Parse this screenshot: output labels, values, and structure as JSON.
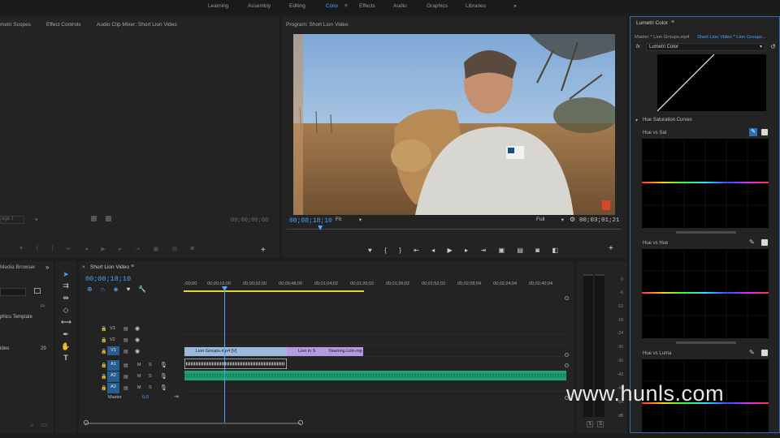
{
  "workspaces": {
    "items": [
      "Learning",
      "Assembly",
      "Editing",
      "Color",
      "Effects",
      "Audio",
      "Graphics",
      "Libraries"
    ],
    "active": "Color",
    "more": "»"
  },
  "source_panel": {
    "tabs": [
      "metri Scopes",
      "Effect Controls",
      "Audio Clip Mixer: Short Lion Video"
    ],
    "timecode_left": "age 1",
    "timecode_right": "00;00;00;00"
  },
  "program": {
    "title": "Program: Short Lion Video",
    "timecode": "00;00;18;10",
    "zoom": "Fit",
    "quality": "Full",
    "duration": "00;03;01;21",
    "playhead_fraction": 0.1
  },
  "lumetri": {
    "title": "Lumetri Color",
    "master_clip": "Master * Lion Groups.mp4",
    "sequence_clip": "Short Lion Video * Lion Groups...",
    "fx_label": "fx",
    "effect_name": "Lumetri Color",
    "section": "Hue Saturation Curves",
    "curves": [
      "Hue vs Sat",
      "Hue vs Hue",
      "Hue vs Luma"
    ]
  },
  "media": {
    "title": "Media Browser",
    "items": [
      "phics Template",
      "ideo"
    ],
    "col_header": "Fr",
    "count": "29"
  },
  "timeline": {
    "title": "Short Lion Video",
    "timecode": "00;00;18;10",
    "ruler": [
      ";00;00",
      "00;00;16;00",
      "00;00;32;00",
      "00;00;48;00",
      "00;01;04;02",
      "00;01;20;02",
      "00;01;36;02",
      "00;01;52;02",
      "00;02;08;04",
      "00;02;24;04",
      "00;02;40;04"
    ],
    "video_tracks": [
      "V3",
      "V2",
      "V1"
    ],
    "audio_tracks": [
      "A1",
      "A2",
      "A3"
    ],
    "target_labels": [
      "V1",
      "A1",
      "A2",
      "A3"
    ],
    "master_label": "Master",
    "master_value": "0.0",
    "clips": {
      "v1_main": "Lion Groups.mp4 [V]",
      "v1_second": "Lion in S",
      "v1_third": "Yawning Lion.mp"
    },
    "mute_label": "M",
    "solo_label": "S"
  },
  "meter": {
    "scale": [
      "0",
      "-6",
      "-12",
      "-18",
      "-24",
      "-30",
      "-36",
      "-42",
      "-48",
      "-54",
      "dB"
    ],
    "solo_buttons": [
      "S",
      "S"
    ]
  },
  "watermark": "www.hunls.com",
  "colors": {
    "accent": "#4ba3ff",
    "v1_clip": "#9bb9dd",
    "v1_clip_purple": "#b49ae0",
    "audio_clip": "#1fa374",
    "work_area": "#e8d43a"
  }
}
